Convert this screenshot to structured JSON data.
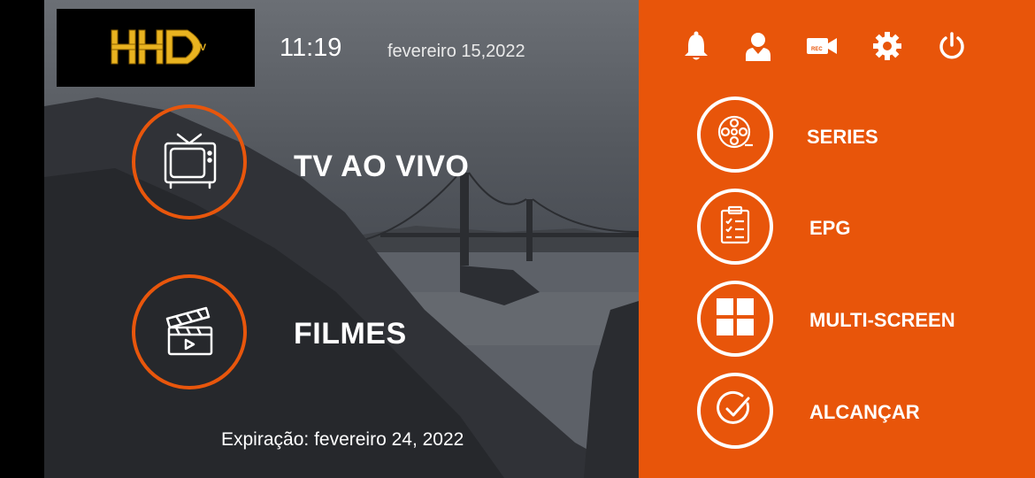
{
  "header": {
    "logo_text": "HHD TV",
    "time": "11:19",
    "date": "fevereiro 15,2022"
  },
  "main_menu": [
    {
      "label": "TV AO VIVO",
      "icon": "tv-icon"
    },
    {
      "label": "FILMES",
      "icon": "clapperboard-icon"
    }
  ],
  "expiry": {
    "label": "Expiração:",
    "value": "fevereiro 24, 2022"
  },
  "top_icons": [
    "bell-icon",
    "user-icon",
    "rec-camera-icon",
    "gear-icon",
    "power-icon"
  ],
  "rec_text": "REC",
  "side_menu": [
    {
      "label": "SERIES",
      "icon": "film-reel-icon"
    },
    {
      "label": "EPG",
      "icon": "clipboard-checklist-icon"
    },
    {
      "label": "MULTI-SCREEN",
      "icon": "grid-icon"
    },
    {
      "label": "ALCANÇAR",
      "icon": "check-circle-icon"
    }
  ],
  "colors": {
    "accent": "#e8550a",
    "text": "#ffffff"
  }
}
